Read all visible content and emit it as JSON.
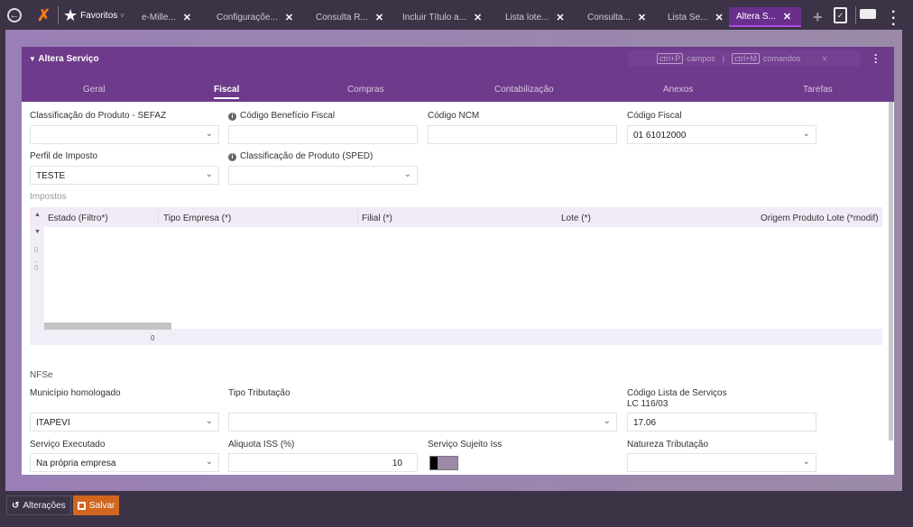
{
  "topbar": {
    "favorites": "Favoritos",
    "tabs": [
      {
        "label": "e-Mille..."
      },
      {
        "label": "Configuraçõe..."
      },
      {
        "label": "Consulta R..."
      },
      {
        "label": "Incluir Título a..."
      },
      {
        "label": "Lista lote..."
      },
      {
        "label": "Consulta..."
      },
      {
        "label": "Lista Se..."
      },
      {
        "label": "Altera S...",
        "active": true
      }
    ]
  },
  "panel": {
    "title": "Altera Serviço",
    "shortcut1_key": "ctrl+P",
    "shortcut1_label": "campos",
    "separator": "|",
    "shortcut2_key": "ctrl+M",
    "shortcut2_label": "comandos",
    "tabs": [
      "Geral",
      "Fiscal",
      "Compras",
      "Contabilização",
      "Anexos",
      "Tarefas"
    ],
    "selected_tab": "Fiscal"
  },
  "form": {
    "classificacao_sefaz": {
      "label": "Classificação do Produto - SEFAZ",
      "value": ""
    },
    "codigo_beneficio": {
      "label": "Código Benefício Fiscal",
      "value": ""
    },
    "codigo_ncm": {
      "label": "Código NCM",
      "value": ""
    },
    "codigo_fiscal": {
      "label": "Código Fiscal",
      "value": "01 61012000"
    },
    "perfil_imposto": {
      "label": "Perfil de Imposto",
      "value": "TESTE"
    },
    "classificacao_sped": {
      "label": "Classificação de Produto (SPED)",
      "value": ""
    },
    "impostos_label": "Impostos",
    "grid": {
      "columns": [
        "Estado (Filtro*)",
        "Tipo Empresa (*)",
        "Filial (*)",
        "Lote (*)",
        "Origem Produto Lote (*modif)"
      ],
      "row_counter_top": "0",
      "row_counter_bottom": "0",
      "footer_count": "0"
    },
    "nfse_label": "NFSe",
    "municipio": {
      "label": "Município homologado",
      "value": "ITAPEVI"
    },
    "tipo_tributacao": {
      "label": "Tipo Tributação",
      "value": ""
    },
    "codigo_lista": {
      "label_line1": "Código Lista de Serviços",
      "label_line2": "LC 116/03",
      "value": "17.06"
    },
    "servico_executado": {
      "label": "Serviço Executado",
      "value": "Na própria empresa"
    },
    "aliquota_iss": {
      "label": "Aliquota ISS (%)",
      "value": "10"
    },
    "servico_sujeito_iss": {
      "label": "Serviço Sujeito Iss",
      "checked": false
    },
    "natureza_tributacao": {
      "label": "Natureza Tributação",
      "value": ""
    }
  },
  "footer": {
    "changes_label": "Alterações",
    "save_label": "Salvar"
  },
  "colors": {
    "accent": "#6e3a8b",
    "save": "#d0661f",
    "topbar": "#3d3347"
  }
}
